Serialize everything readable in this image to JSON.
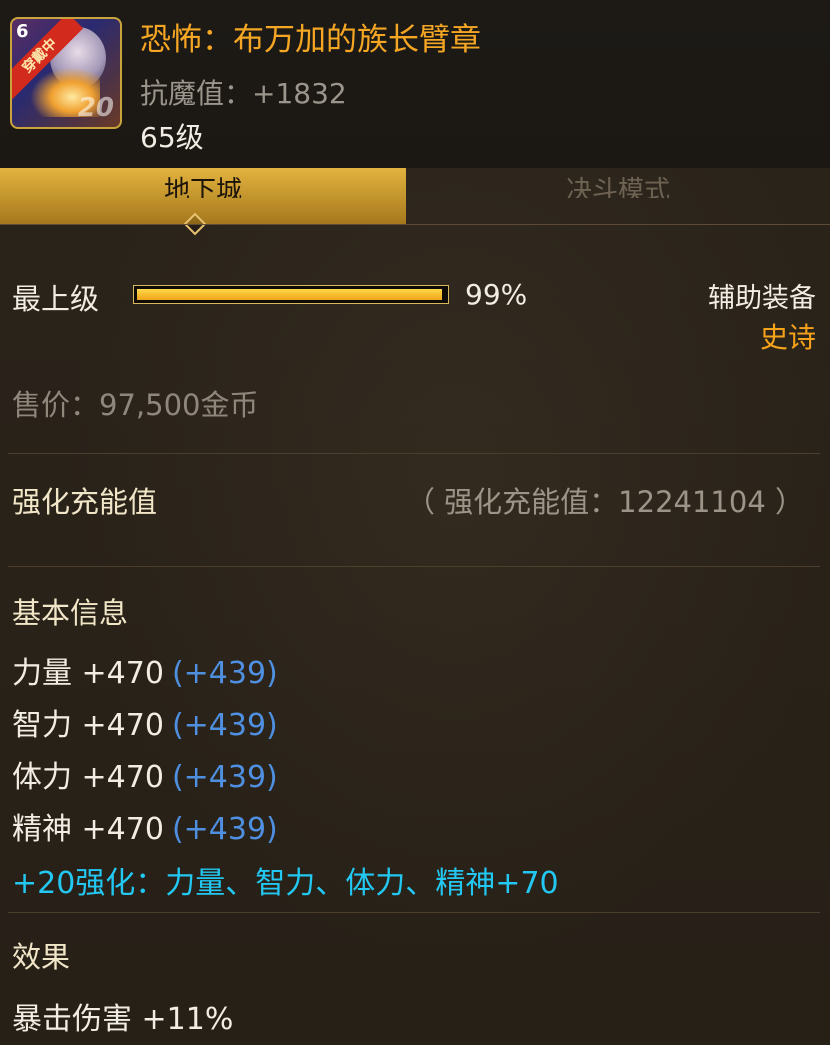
{
  "item": {
    "icon_corner_number": "6",
    "icon_ribbon": "穿戴中",
    "icon_enhance": "20",
    "name": "恐怖：布万加的族长臂章",
    "stat_line": "抗魔值：+1832",
    "level": "65级"
  },
  "tabs": [
    {
      "label": "地下城",
      "active": true
    },
    {
      "label": "决斗模式",
      "active": false
    }
  ],
  "grade": {
    "label": "最上级",
    "progress_percent": 99,
    "progress_text": "99%",
    "equip_type": "辅助装备",
    "rarity": "史诗"
  },
  "price": "售价：97,500金币",
  "charge": {
    "label": "强化充能值",
    "value": "（ 强化充能值：12241104 ）"
  },
  "basic_info": {
    "title": "基本信息",
    "stats": [
      {
        "text": "力量 +470",
        "bonus": "(+439)"
      },
      {
        "text": "智力 +470",
        "bonus": "(+439)"
      },
      {
        "text": "体力 +470",
        "bonus": "(+439)"
      },
      {
        "text": "精神 +470",
        "bonus": "(+439)"
      }
    ],
    "enhance": "+20强化：力量、智力、体力、精神+70"
  },
  "effects": {
    "title": "效果",
    "items": [
      "暴击伤害 +11%"
    ]
  },
  "colors": {
    "item_name": "#f5a623",
    "rarity": "#f7a21b",
    "bonus": "#4f8fe0",
    "enhance": "#22c8f2",
    "tab_active": "#e2b33e"
  }
}
